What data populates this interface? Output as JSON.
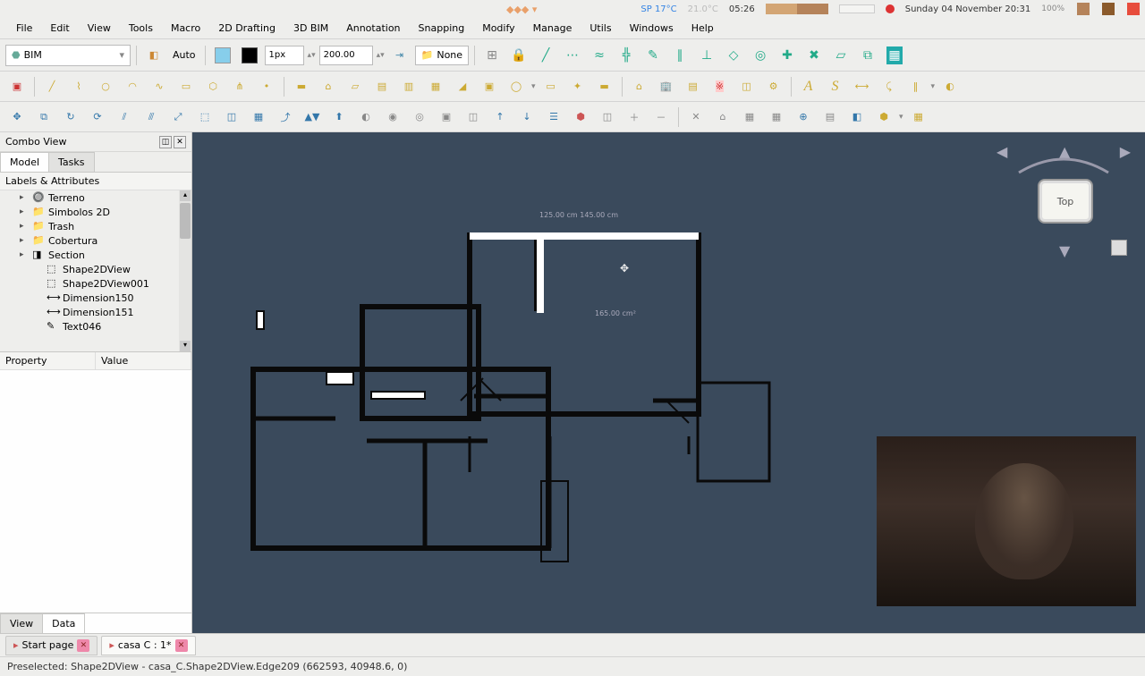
{
  "system": {
    "weather": "SP 17°C",
    "clock": "05:26",
    "date": "Sunday 04 November 20:31",
    "battery": "100%"
  },
  "menus": [
    "File",
    "Edit",
    "View",
    "Tools",
    "Macro",
    "2D Drafting",
    "3D BIM",
    "Annotation",
    "Snapping",
    "Modify",
    "Manage",
    "Utils",
    "Windows",
    "Help"
  ],
  "workbench": "BIM",
  "draft": {
    "constmode": "Auto",
    "lineWidth": "1px",
    "gridSpacing": "200.00",
    "autogroup": "None"
  },
  "comboView": {
    "title": "Combo View",
    "tabs": [
      "Model",
      "Tasks"
    ],
    "activeTab": 0,
    "treeHeader": "Labels & Attributes",
    "tree": [
      {
        "label": "Terreno",
        "icon": "sphere",
        "expandable": true,
        "indent": 1
      },
      {
        "label": "Simbolos 2D",
        "icon": "folder",
        "expandable": true,
        "indent": 1
      },
      {
        "label": "Trash",
        "icon": "folder",
        "expandable": true,
        "indent": 1
      },
      {
        "label": "Cobertura",
        "icon": "folder",
        "expandable": true,
        "indent": 1
      },
      {
        "label": "Section",
        "icon": "section",
        "expandable": true,
        "indent": 1
      },
      {
        "label": "Shape2DView",
        "icon": "shape2d",
        "expandable": false,
        "indent": 2
      },
      {
        "label": "Shape2DView001",
        "icon": "shape2d",
        "expandable": false,
        "indent": 2
      },
      {
        "label": "Dimension150",
        "icon": "dim",
        "expandable": false,
        "indent": 2
      },
      {
        "label": "Dimension151",
        "icon": "dim",
        "expandable": false,
        "indent": 2
      },
      {
        "label": "Text046",
        "icon": "text",
        "expandable": false,
        "indent": 2
      }
    ],
    "propCols": [
      "Property",
      "Value"
    ],
    "propTabs": [
      "View",
      "Data"
    ],
    "activePropTab": 1
  },
  "viewport": {
    "dimText": "125.00 cm   145.00 cm",
    "roomLabel": "165.00 cm²",
    "navView": "Top"
  },
  "docTabs": [
    {
      "label": "Start page",
      "active": false
    },
    {
      "label": "casa C : 1*",
      "active": true
    }
  ],
  "status": "Preselected: Shape2DView - casa_C.Shape2DView.Edge209 (662593, 40948.6, 0)"
}
